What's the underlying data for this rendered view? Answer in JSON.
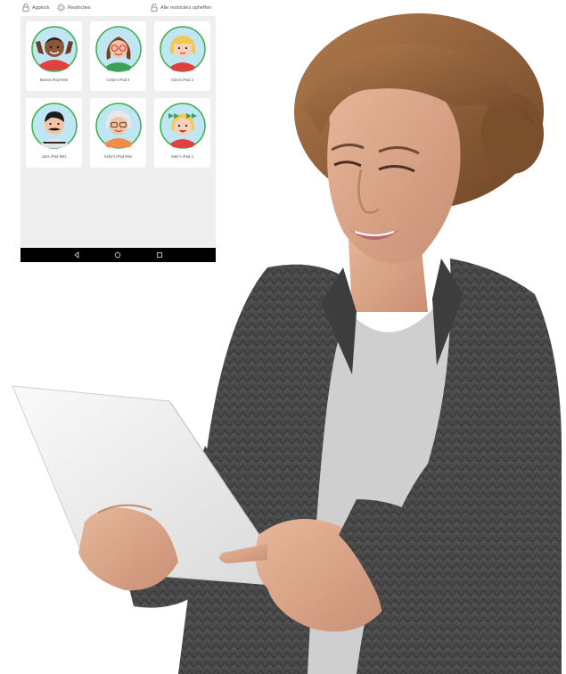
{
  "toolbar": {
    "applock_label": "Applock",
    "restrictions_label": "Restricties",
    "lift_all_label": "Alle restricties opheffen"
  },
  "devices": [
    {
      "name": "Brams iPad Mini",
      "avatar": "boy-dark"
    },
    {
      "name": "Celia's iPad 4",
      "avatar": "girl-glasses"
    },
    {
      "name": "Clea's iPad 2",
      "avatar": "girl-blonde"
    },
    {
      "name": "Jans iPad Mini",
      "avatar": "man-mustache"
    },
    {
      "name": "Kelly's iPad Mini",
      "avatar": "grandma"
    },
    {
      "name": "Mari's iPad 3",
      "avatar": "girl-bows"
    }
  ],
  "colors": {
    "avatar_bg": "#bfe6f2",
    "avatar_ring": "#3cae4a",
    "phone_bg": "#efefef",
    "navbar": "#000000"
  },
  "navbar_icons": [
    "back-icon",
    "home-icon",
    "recents-icon"
  ]
}
